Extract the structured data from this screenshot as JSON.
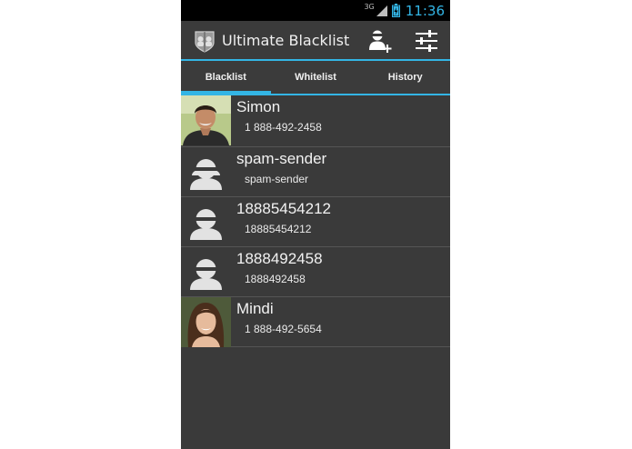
{
  "status_bar": {
    "network": "3G",
    "time": "11:36"
  },
  "app": {
    "title": "Ultimate Blacklist"
  },
  "tabs": [
    {
      "label": "Blacklist",
      "active": true
    },
    {
      "label": "Whitelist",
      "active": false
    },
    {
      "label": "History",
      "active": false
    }
  ],
  "contacts": [
    {
      "name": "Simon",
      "number": "1 888-492-2458",
      "avatar": "photo-man"
    },
    {
      "name": "spam-sender",
      "number": "spam-sender",
      "avatar": "default-person-icon"
    },
    {
      "name": "18885454212",
      "number": "18885454212",
      "avatar": "default-person-icon"
    },
    {
      "name": "1888492458",
      "number": "1888492458",
      "avatar": "default-person-icon"
    },
    {
      "name": "Mindi",
      "number": "1 888-492-5654",
      "avatar": "photo-woman"
    }
  ],
  "colors": {
    "accent": "#33b5e5",
    "background": "#3a3a3a",
    "bar": "#3b3b3b"
  }
}
